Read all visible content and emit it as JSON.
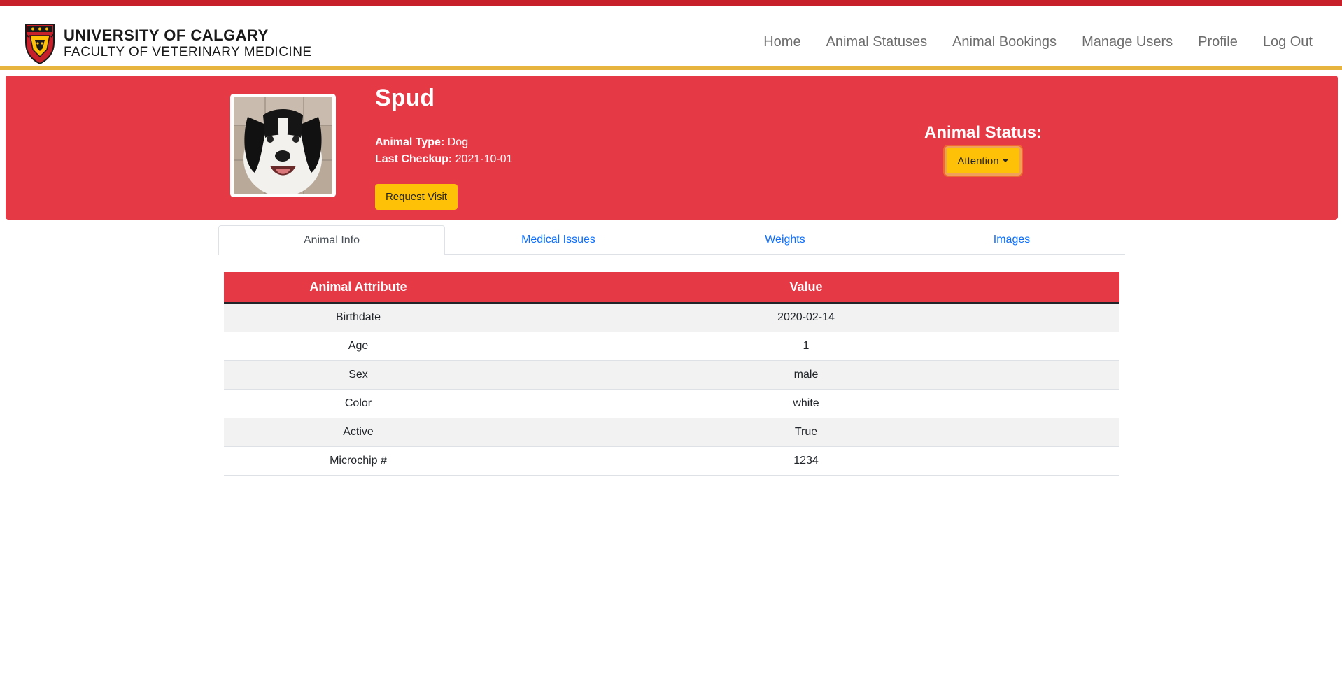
{
  "brand": {
    "line1": "UNIVERSITY OF CALGARY",
    "line2": "FACULTY OF VETERINARY MEDICINE",
    "logo_icon": "university-crest-icon"
  },
  "nav": {
    "items": [
      "Home",
      "Animal Statuses",
      "Animal Bookings",
      "Manage Users",
      "Profile",
      "Log Out"
    ]
  },
  "animal": {
    "name": "Spud",
    "type_label": "Animal Type:",
    "type_value": "Dog",
    "checkup_label": "Last Checkup:",
    "checkup_value": "2021-10-01",
    "photo_icon": "dog-photo"
  },
  "actions": {
    "request_visit": "Request Visit"
  },
  "status": {
    "label": "Animal Status:",
    "selected": "Attention"
  },
  "tabs": [
    {
      "label": "Animal Info",
      "active": true
    },
    {
      "label": "Medical Issues",
      "active": false
    },
    {
      "label": "Weights",
      "active": false
    },
    {
      "label": "Images",
      "active": false
    }
  ],
  "table": {
    "headers": [
      "Animal Attribute",
      "Value"
    ],
    "rows": [
      [
        "Birthdate",
        "2020-02-14"
      ],
      [
        "Age",
        "1"
      ],
      [
        "Sex",
        "male"
      ],
      [
        "Color",
        "white"
      ],
      [
        "Active",
        "True"
      ],
      [
        "Microchip #",
        "1234"
      ]
    ]
  },
  "colors": {
    "banner": "#e63946",
    "top_strip": "#c8202a",
    "underline": "#e7b43d",
    "button": "#ffc107",
    "link": "#0d6efd"
  }
}
